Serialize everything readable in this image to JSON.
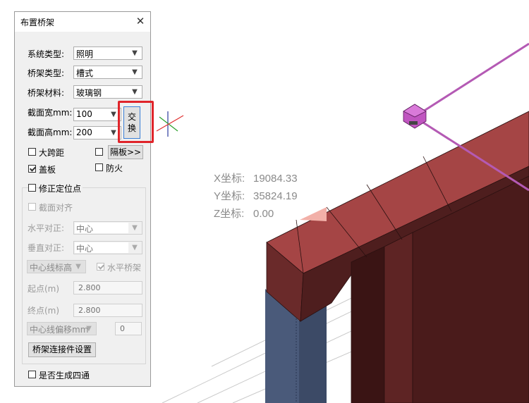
{
  "dialog": {
    "title": "布置桥架",
    "close_glyph": "✕",
    "system_type": {
      "label": "系统类型:",
      "value": "照明"
    },
    "tray_type": {
      "label": "桥架类型:",
      "value": "槽式"
    },
    "tray_material": {
      "label": "桥架材料:",
      "value": "玻璃钢"
    },
    "section_width": {
      "label": "截面宽mm:",
      "value": "100"
    },
    "section_height": {
      "label": "截面高mm:",
      "value": "200"
    },
    "swap_button": {
      "line1": "交",
      "line2": "换"
    },
    "large_span": {
      "label": "大跨距",
      "checked": false
    },
    "partition": {
      "checked": false,
      "button_label": "隔板>>"
    },
    "cover": {
      "label": "盖板",
      "checked": true
    },
    "fireproof": {
      "label": "防火",
      "checked": false
    },
    "fix_position": {
      "label": "修正定位点",
      "checked": false
    },
    "section_align": {
      "label": "截面对齐",
      "checked": false
    },
    "horizontal_align": {
      "label": "水平对正:",
      "value": "中心"
    },
    "vertical_align": {
      "label": "垂直对正:",
      "value": "中心"
    },
    "centerline_elevation": {
      "value": "中心线标高"
    },
    "horizontal_tray": {
      "label": "水平桥架",
      "checked": true
    },
    "start_point": {
      "label": "起点(m)",
      "value": "2.800"
    },
    "end_point": {
      "label": "终点(m)",
      "value": "2.800"
    },
    "centerline_offset": {
      "value": "中心线偏移mm",
      "input_value": "0"
    },
    "connector_settings": {
      "label": "桥架连接件设置"
    },
    "generate_cross": {
      "label": "是否生成四通",
      "checked": false
    }
  },
  "coordinates": {
    "x": {
      "label": "X坐标:",
      "value": "19084.33"
    },
    "y": {
      "label": "Y坐标:",
      "value": "35824.19"
    },
    "z": {
      "label": "Z坐标:",
      "value": "0.00"
    }
  },
  "colors": {
    "tray_red": "#9e4040",
    "tray_dark": "#5a2323",
    "column_blue": "#4a5a7a",
    "pipe_pink": "#b45ab4",
    "highlight_red": "#e0242a",
    "axis_cyan": "#6fe0e0"
  }
}
